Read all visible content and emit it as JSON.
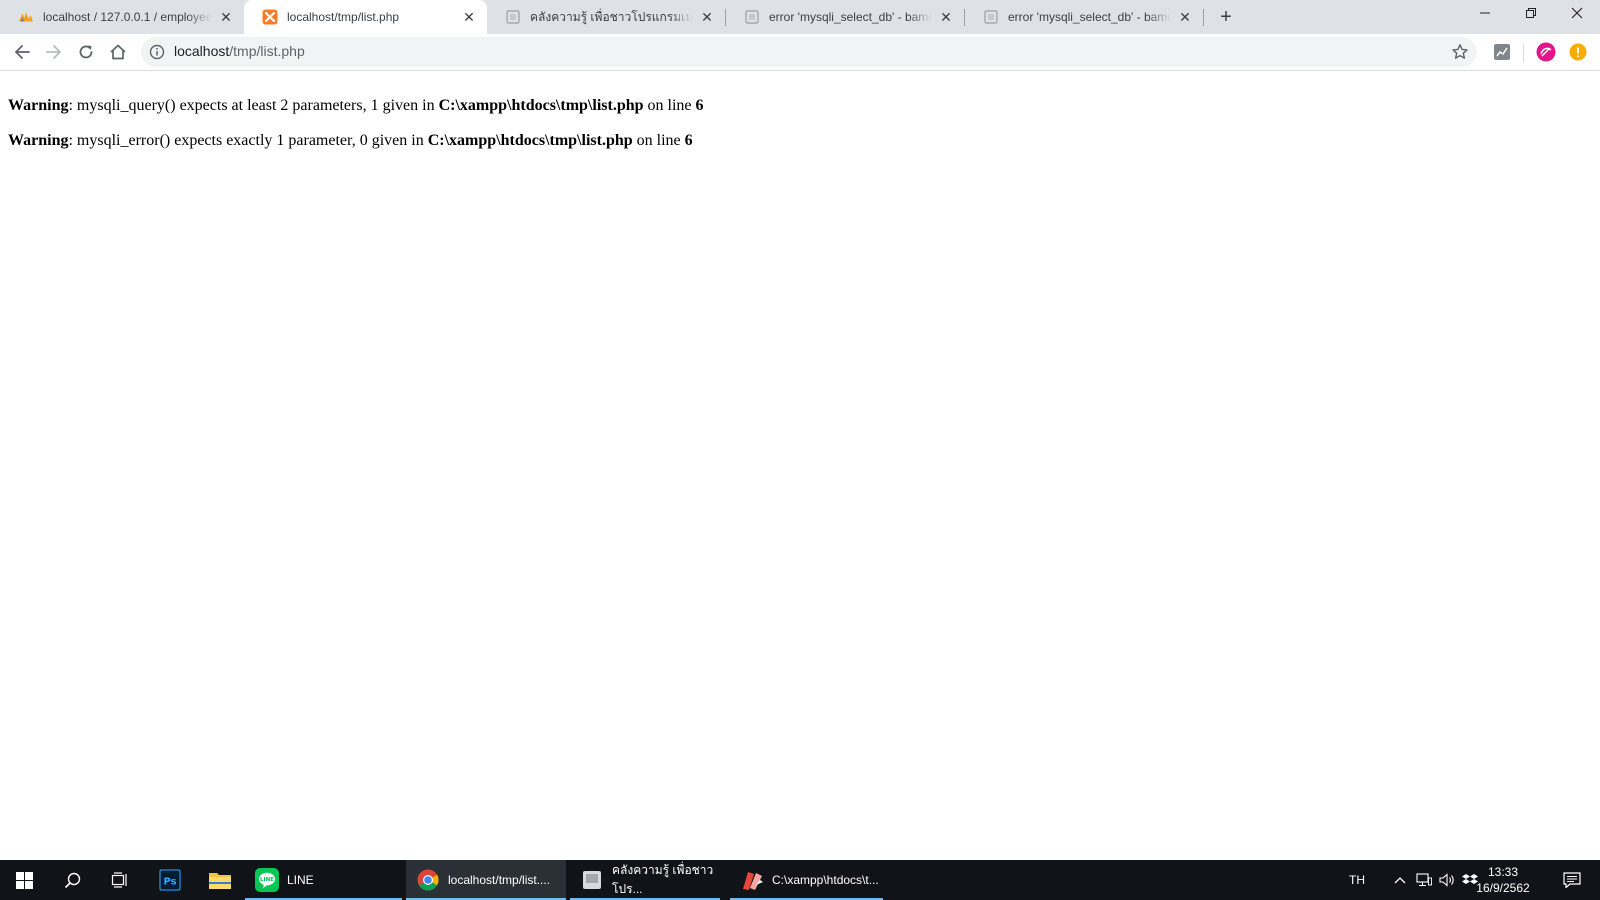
{
  "browser": {
    "tabs": [
      {
        "title": "localhost / 127.0.0.1 / employee / ",
        "favicon": "phpmyadmin-icon"
      },
      {
        "title": "localhost/tmp/list.php",
        "favicon": "xampp-icon",
        "active": true
      },
      {
        "title": "คลังความรู้ เพื่อชาวโปรแกรมเมอร์มือใหม่",
        "favicon": "page-icon"
      },
      {
        "title": "error 'mysqli_select_db' - bamoss",
        "favicon": "page-icon"
      },
      {
        "title": "error 'mysqli_select_db' - bamoss",
        "favicon": "page-icon"
      }
    ],
    "new_tab": "+",
    "address": {
      "host": "localhost",
      "path": "/tmp/list.php"
    }
  },
  "page": {
    "warnings": [
      {
        "label": "Warning",
        "message": ": mysqli_query() expects at least 2 parameters, 1 given in ",
        "file": "C:\\xampp\\htdocs\\tmp\\list.php",
        "on_line": " on line ",
        "line": "6"
      },
      {
        "label": "Warning",
        "message": ": mysqli_error() expects exactly 1 parameter, 0 given in ",
        "file": "C:\\xampp\\htdocs\\tmp\\list.php",
        "on_line": " on line ",
        "line": "6"
      }
    ]
  },
  "taskbar": {
    "apps": [
      {
        "label": "LINE",
        "icon": "line-icon"
      },
      {
        "label": "localhost/tmp/list....",
        "icon": "chrome-icon",
        "active": true
      },
      {
        "label": "คลังความรู้ เพื่อชาวโปร...",
        "icon": "document-icon"
      },
      {
        "label": "C:\\xampp\\htdocs\\t...",
        "icon": "editor-icon"
      }
    ],
    "language": "TH",
    "time": "13:33",
    "date": "16/9/2562"
  },
  "colors": {
    "tabstrip": "#dee1e6",
    "taskbar": "#101419",
    "accent": "#76b9ed"
  }
}
